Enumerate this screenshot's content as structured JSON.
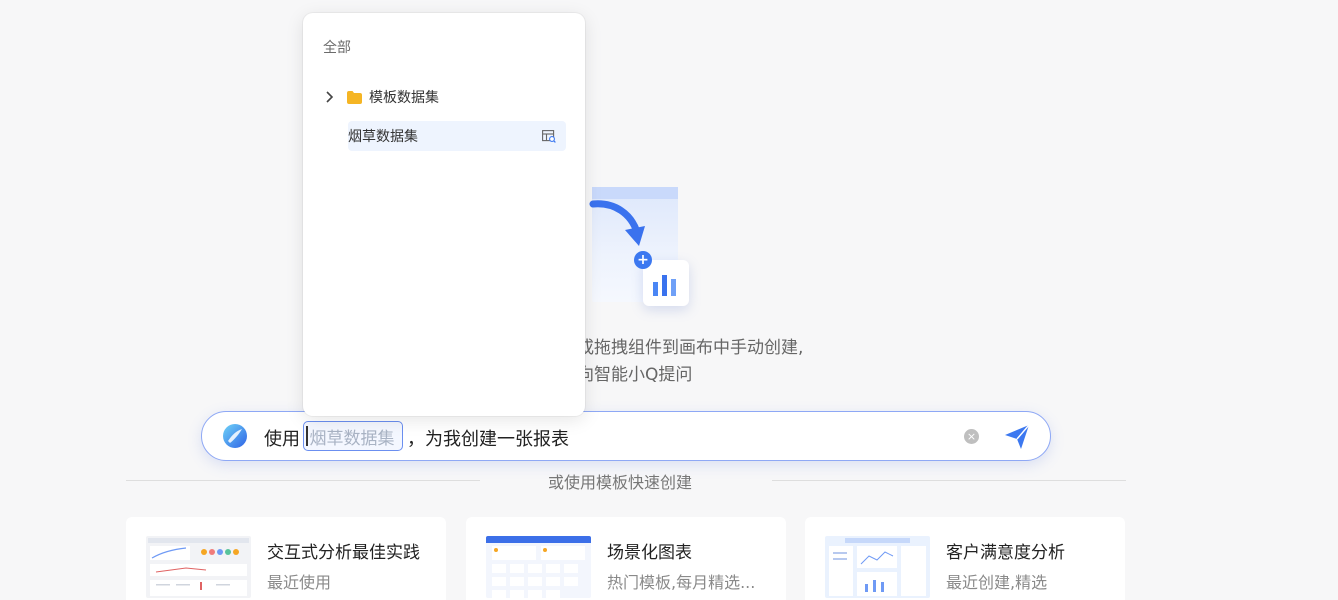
{
  "dropdown": {
    "header": "全部",
    "folder": {
      "label": "模板数据集",
      "icon": "folder-icon",
      "color": "#f5b524"
    },
    "dataset": {
      "label": "烟草数据集",
      "icon": "dataset-icon"
    }
  },
  "empty_state": {
    "line1": "舌或拖拽组件到画布中手动创建,",
    "line2": "以向智能小Q提问"
  },
  "chat": {
    "prefix": "使用",
    "chip_placeholder": "烟草数据集",
    "suffix": "，为我创建一张报表"
  },
  "divider": {
    "text": "或使用模板快速创建"
  },
  "templates": [
    {
      "title": "交互式分析最佳实践",
      "subtitle": "最近使用"
    },
    {
      "title": "场景化图表",
      "subtitle": "热门模板,每月精选..."
    },
    {
      "title": "客户满意度分析",
      "subtitle": "最近创建,精选"
    }
  ],
  "colors": {
    "accent": "#3c78f0",
    "selected_bg": "#eef4fe",
    "folder": "#f5b524"
  }
}
